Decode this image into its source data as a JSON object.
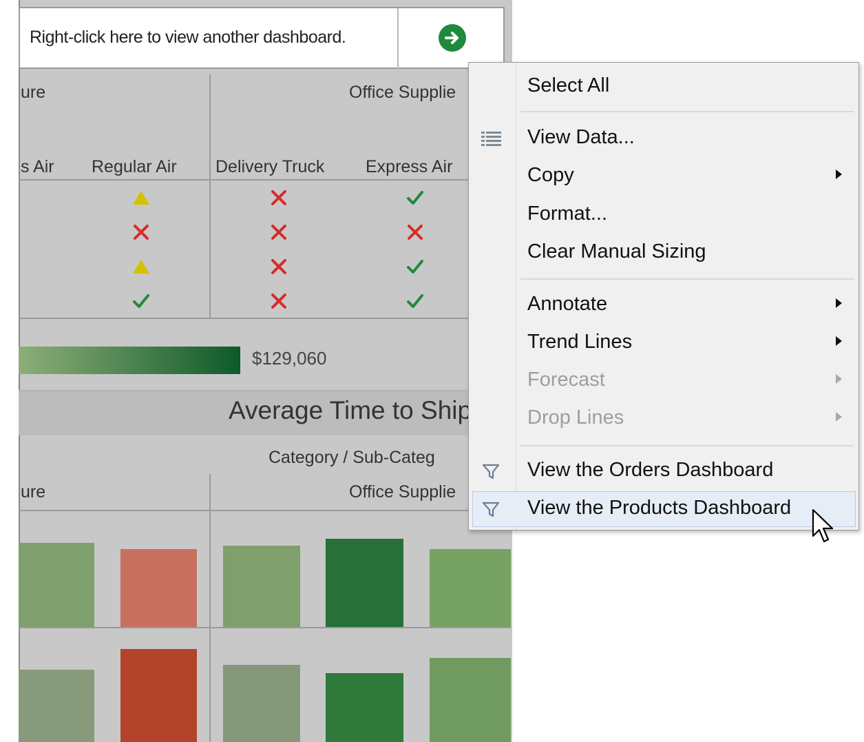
{
  "banner": {
    "text": "Right-click here to view another dashboard."
  },
  "headers": {
    "category_left": "ure",
    "category_right": "Office Supplie",
    "ship_modes": [
      "s Air",
      "Regular Air",
      "Delivery Truck",
      "Express Air"
    ]
  },
  "marks": [
    [
      "warning",
      "cross",
      "check"
    ],
    [
      "cross",
      "cross",
      "cross"
    ],
    [
      "warning",
      "cross",
      "check"
    ],
    [
      "check",
      "cross",
      "check"
    ]
  ],
  "legend": {
    "value": "$129,060"
  },
  "section": {
    "title": "Average Time to Ship",
    "category_label": "Category / Sub-Categ",
    "category_left": "ure",
    "category_right": "Office Supplie"
  },
  "menu": {
    "select_all": "Select All",
    "view_data": "View Data...",
    "copy": "Copy",
    "format": "Format...",
    "clear_sizing": "Clear Manual Sizing",
    "annotate": "Annotate",
    "trend_lines": "Trend Lines",
    "forecast": "Forecast",
    "drop_lines": "Drop Lines",
    "view_orders": "View the Orders Dashboard",
    "view_products": "View the Products Dashboard"
  },
  "icons": {
    "nav": "arrow-right-circle-icon",
    "view_data": "table-icon",
    "filter": "filter-funnel-icon",
    "cursor": "mouse-pointer-icon"
  },
  "colors": {
    "check": "#1f8a3c",
    "cross": "#d62b2b",
    "warning": "#d4c100",
    "menu_bg": "#f0f0f0",
    "highlight": "#e6edf7"
  }
}
